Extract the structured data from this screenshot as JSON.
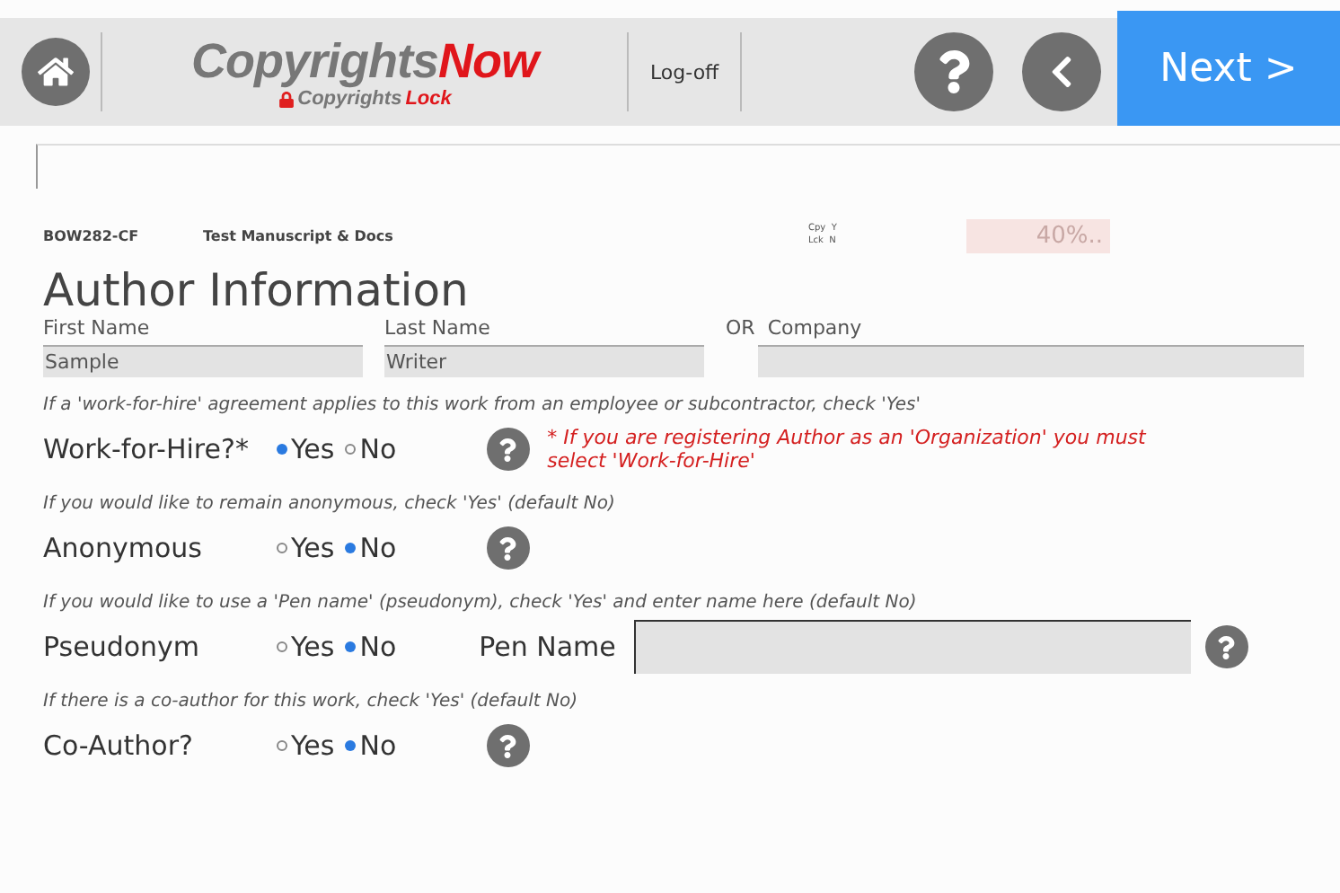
{
  "header": {
    "logo": {
      "main": "Copyrights",
      "accent": "Now"
    },
    "sub_logo": {
      "main": "Copyrights",
      "accent": "Lock"
    },
    "logoff": "Log-off",
    "next": "Next >"
  },
  "info": {
    "code": "BOW282-CF",
    "title": "Test Manuscript & Docs",
    "flags": [
      {
        "label": "Cpy",
        "value": "Y"
      },
      {
        "label": "Lck",
        "value": "N"
      }
    ],
    "progress": "40%.."
  },
  "section_title": "Author Information",
  "name_fields": [
    {
      "label": "First Name",
      "value": "Sample"
    },
    {
      "label": "Last Name",
      "value": "Writer"
    }
  ],
  "or_label": "OR",
  "company": {
    "label": "Company"
  },
  "questions": [
    {
      "hint": "If a 'work-for-hire' agreement applies to this work from an employee or subcontractor, check 'Yes'",
      "label": "Work-for-Hire?*",
      "options": [
        {
          "label": "Yes",
          "selected": true
        },
        {
          "label": "No",
          "selected": false
        }
      ],
      "note": "* If you are registering Author as an 'Organization' you must select 'Work-for-Hire'"
    },
    {
      "hint": "If you would like to remain anonymous, check 'Yes' (default No)",
      "label": "Anonymous",
      "options": [
        {
          "label": "Yes",
          "selected": false
        },
        {
          "label": "No",
          "selected": true
        }
      ]
    },
    {
      "hint": "If you would like to use a 'Pen name' (pseudonym), check 'Yes' and enter name here (default No)",
      "label": "Pseudonym",
      "options": [
        {
          "label": "Yes",
          "selected": false
        },
        {
          "label": "No",
          "selected": true
        }
      ],
      "pen_name_label": "Pen Name"
    },
    {
      "hint": "If there is a co-author for this work, check 'Yes' (default No)",
      "label": "Co-Author?",
      "options": [
        {
          "label": "Yes",
          "selected": false
        },
        {
          "label": "No",
          "selected": true
        }
      ]
    }
  ]
}
